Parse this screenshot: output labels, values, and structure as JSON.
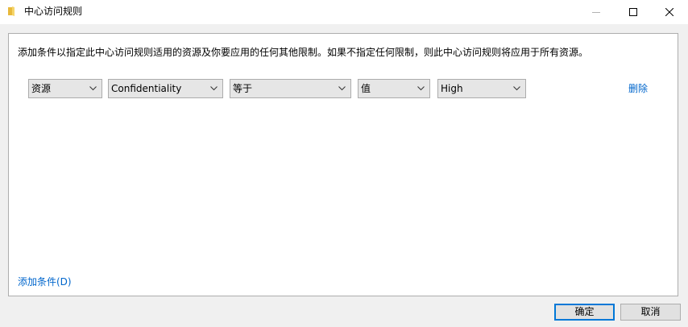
{
  "window": {
    "title": "中心访问规则",
    "icon": "folder-icon"
  },
  "description": "添加条件以指定此中心访问规则适用的资源及你要应用的任何其他限制。如果不指定任何限制，则此中心访问规则将应用于所有资源。",
  "condition": {
    "source": "资源",
    "attribute": "Confidentiality",
    "operator": "等于",
    "value_type": "值",
    "value": "High",
    "delete_label": "删除"
  },
  "add_condition_label": "添加条件(D)",
  "buttons": {
    "ok": "确定",
    "cancel": "取消"
  },
  "colors": {
    "link": "#0066cc",
    "focus_border": "#0078d7"
  }
}
